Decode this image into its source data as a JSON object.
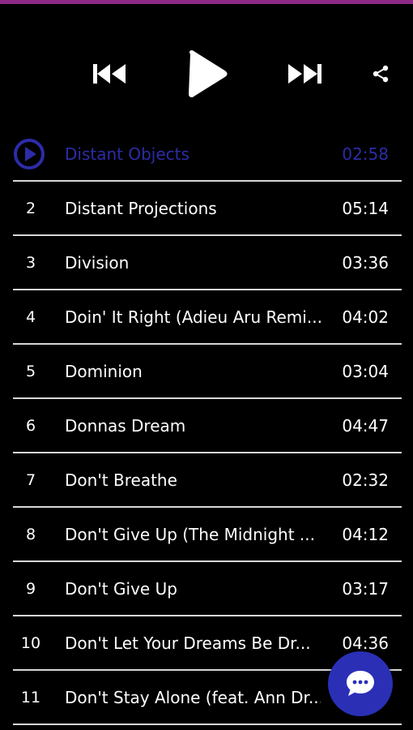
{
  "player": {
    "controls": {
      "previous_icon": "skip-previous-icon",
      "play_icon": "play-icon",
      "next_icon": "skip-next-icon",
      "share_icon": "share-icon"
    },
    "accent_color": "#2c2ca8",
    "top_bar_color": "#8e2a86"
  },
  "tracks": [
    {
      "number": "",
      "title": "Distant Objects",
      "duration": "02:58",
      "current": true
    },
    {
      "number": "2",
      "title": "Distant Projections",
      "duration": "05:14"
    },
    {
      "number": "3",
      "title": "Division",
      "duration": "03:36"
    },
    {
      "number": "4",
      "title": "Doin' It Right (Adieu Aru Remi...",
      "duration": "04:02"
    },
    {
      "number": "5",
      "title": "Dominion",
      "duration": "03:04"
    },
    {
      "number": "6",
      "title": "Donnas Dream",
      "duration": "04:47"
    },
    {
      "number": "7",
      "title": "Don't Breathe",
      "duration": "02:32"
    },
    {
      "number": "8",
      "title": "Don't Give Up (The Midnight ...",
      "duration": "04:12"
    },
    {
      "number": "9",
      "title": "Don't Give Up",
      "duration": "03:17"
    },
    {
      "number": "10",
      "title": "Don't Let Your Dreams Be Dr...",
      "duration": "04:36"
    },
    {
      "number": "11",
      "title": "Don't Stay Alone (feat. Ann Dr...",
      "duration": ""
    }
  ],
  "fab": {
    "icon": "chat-bubble-icon",
    "color": "#2a2fb6"
  }
}
